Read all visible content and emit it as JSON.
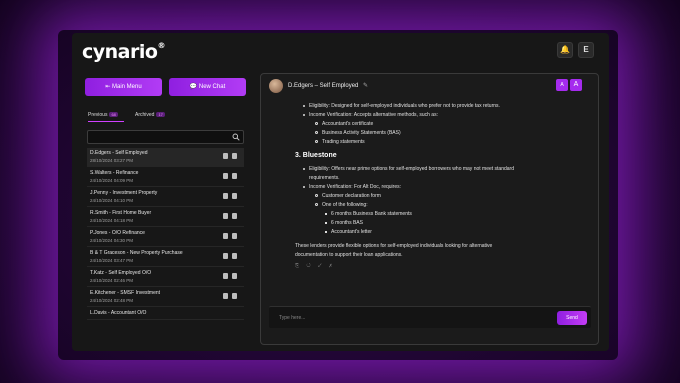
{
  "app": {
    "brand": "cynario",
    "brand_mark": "®"
  },
  "header": {
    "bell_glyph": "🔔",
    "user_initial": "E"
  },
  "sidebar": {
    "main_menu_label": "⇤ Main Menu",
    "new_chat_label": "💬 New Chat",
    "tabs": [
      {
        "label": "Previous",
        "count": "68"
      },
      {
        "label": "Archived",
        "count": "17"
      }
    ],
    "search": {
      "placeholder": ""
    },
    "items": [
      {
        "name": "D.Edgers - Self Employed",
        "date": "28/10/2024 03:27 PM"
      },
      {
        "name": "S.Walters - Refinance",
        "date": "24/10/2024 04:09 PM"
      },
      {
        "name": "J.Penny - Investment Property",
        "date": "24/10/2024 04:10 PM"
      },
      {
        "name": "R.Smith - First Home Buyer",
        "date": "24/10/2024 04:18 PM"
      },
      {
        "name": "P.Jones - O/O Refinance",
        "date": "24/10/2024 04:30 PM"
      },
      {
        "name": "B & T Graceson - New Property Purchase",
        "date": "24/10/2024 03:47 PM"
      },
      {
        "name": "T.Katz - Self Employed O/O",
        "date": "24/10/2024 02:46 PM"
      },
      {
        "name": "E.Kitchener - SMSF Investment",
        "date": "24/10/2024 02:48 PM"
      },
      {
        "name": "L.Davis - Accountant O/O",
        "date": ""
      }
    ]
  },
  "chat": {
    "title": "D.Edgers – Self Employed",
    "edit_glyph": "✎",
    "font_btn_small": "A",
    "font_btn_large": "A",
    "lines": {
      "l1": "Eligibility: Designed for self-employed individuals who prefer not to provide tax returns.",
      "l2": "Income Verification: Accepts alternative methods, such as:",
      "l3": "Accountant's certificate",
      "l4": "Business Activity Statements (BAS)",
      "l5": "Trading statements",
      "h3": "3. Bluestone",
      "l6": "Eligibility: Offers near prime options for self-employed borrowers who may not meet standard",
      "l6b": "requirements.",
      "l7": "Income Verification: For Alt Doc, requires:",
      "l8": "Customer declaration form",
      "l9": "One of the following:",
      "l10": "6 months Business Bank statements",
      "l11": "6 months BAS",
      "l12": "Accountant's letter",
      "p1": "These lenders provide flexible options for self-employed individuals looking for alternative",
      "p2": "documentation to support their loan applications."
    },
    "reactions": "⎘ ↺ ✓ ✗",
    "input_placeholder": "Type here...",
    "send_label": "Send"
  }
}
